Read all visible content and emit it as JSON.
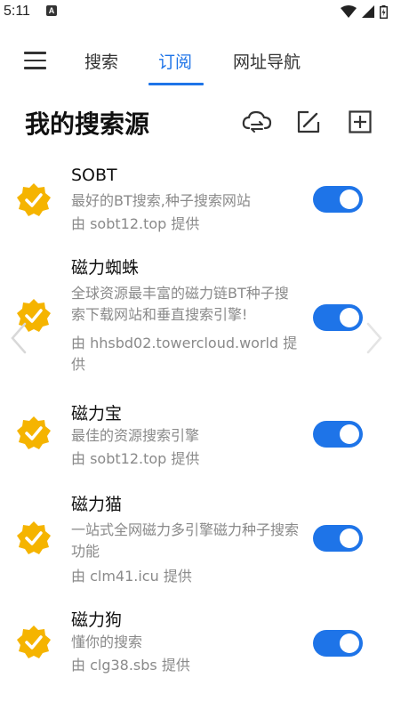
{
  "status_bar": {
    "time": "5:11",
    "notification_letter": "A"
  },
  "nav": {
    "tabs": [
      {
        "label": "搜索",
        "active": false
      },
      {
        "label": "订阅",
        "active": true
      },
      {
        "label": "网址导航",
        "active": false
      }
    ]
  },
  "page": {
    "title": "我的搜索源"
  },
  "actions": [
    "cloud-sync-icon",
    "edit-icon",
    "add-icon"
  ],
  "sources": [
    {
      "name": "SOBT",
      "desc": "最好的BT搜索,种子搜索网站",
      "provider": "由 sobt12.top 提供",
      "enabled": true
    },
    {
      "name": "磁力蜘蛛",
      "desc": "全球资源最丰富的磁力链BT种子搜索下载网站和垂直搜索引擎!",
      "provider": "由 hhsbd02.towercloud.world 提供",
      "enabled": true
    },
    {
      "name": "磁力宝",
      "desc": "最佳的资源搜索引擎",
      "provider": "由 sobt12.top 提供",
      "enabled": true
    },
    {
      "name": "磁力猫",
      "desc": "一站式全网磁力多引擎磁力种子搜索功能",
      "provider": "由 clm41.icu 提供",
      "enabled": true
    },
    {
      "name": "磁力狗",
      "desc": "懂你的搜索",
      "provider": "由 clg38.sbs 提供",
      "enabled": true
    }
  ],
  "colors": {
    "accent": "#1e74e8",
    "badge": "#f5b400",
    "secondary_text": "#8a8a8a"
  }
}
